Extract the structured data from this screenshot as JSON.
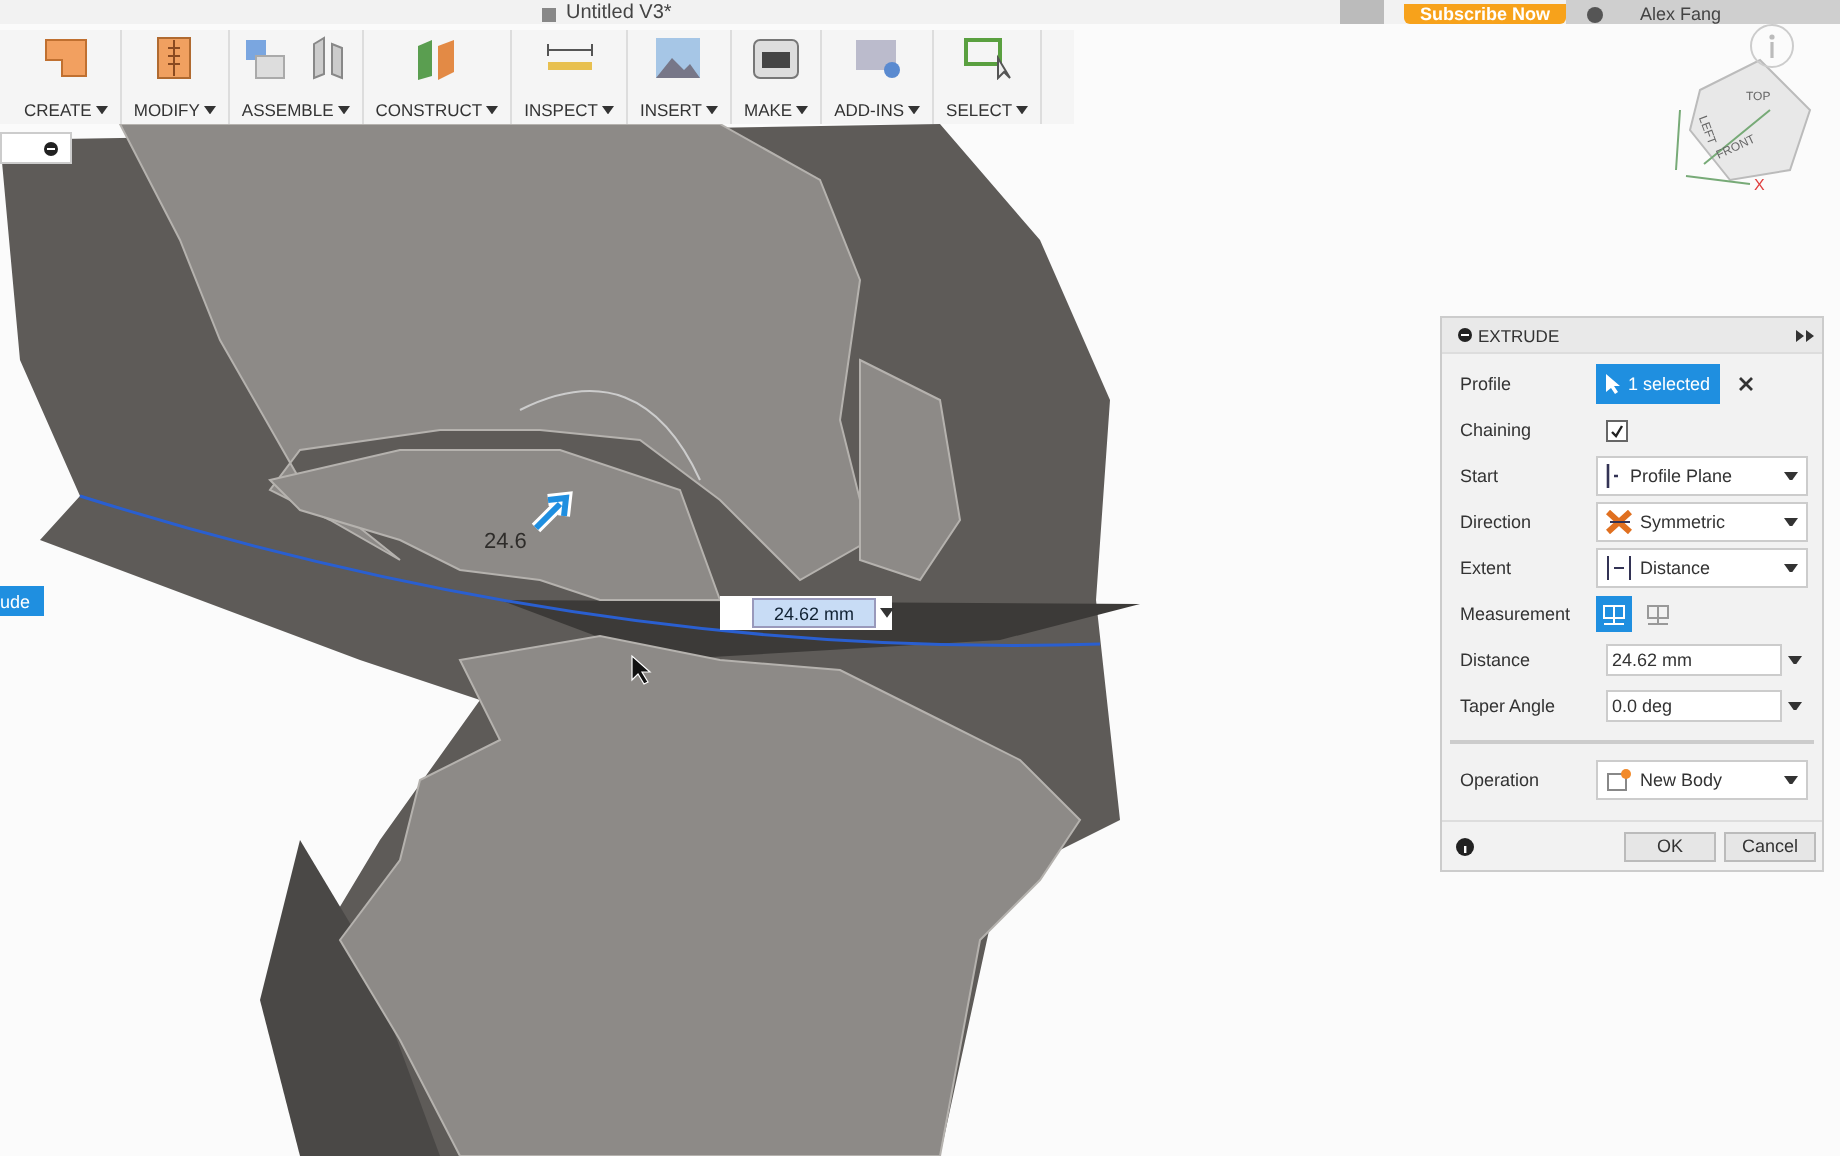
{
  "title_bar": {
    "document_title": "Untitled V3*",
    "subscribe_button": "Subscribe Now",
    "user_name": "Alex Fang"
  },
  "toolbar": [
    {
      "label": "CREATE"
    },
    {
      "label": "MODIFY"
    },
    {
      "label": "ASSEMBLE"
    },
    {
      "label": "CONSTRUCT"
    },
    {
      "label": "INSPECT"
    },
    {
      "label": "INSERT"
    },
    {
      "label": "MAKE"
    },
    {
      "label": "ADD-INS"
    },
    {
      "label": "SELECT"
    }
  ],
  "timeline_label": "ude",
  "viewport": {
    "dimension_label": "24.6",
    "distance_input": "24.62 mm"
  },
  "view_cube": {
    "faces": [
      "LEFT",
      "TOP",
      "FRONT"
    ],
    "axis": "X"
  },
  "extrude_panel": {
    "title": "EXTRUDE",
    "rows": [
      {
        "kind": "selection",
        "label": "Profile",
        "value": "1 selected"
      },
      {
        "kind": "checkbox",
        "label": "Chaining",
        "checked": true
      },
      {
        "kind": "dropdown",
        "label": "Start",
        "value": "Profile Plane"
      },
      {
        "kind": "dropdown",
        "label": "Direction",
        "value": "Symmetric"
      },
      {
        "kind": "dropdown",
        "label": "Extent",
        "value": "Distance"
      },
      {
        "kind": "toggle",
        "label": "Measurement",
        "options": [
          {
            "selected": true
          },
          {
            "selected": false
          }
        ]
      },
      {
        "kind": "number",
        "label": "Distance",
        "value": "24.62 mm"
      },
      {
        "kind": "number",
        "label": "Taper Angle",
        "value": "0.0 deg"
      }
    ],
    "output_rows": [
      {
        "kind": "dropdown",
        "label": "Operation",
        "value": "New Body"
      }
    ],
    "buttons": [
      "OK",
      "Cancel"
    ]
  }
}
